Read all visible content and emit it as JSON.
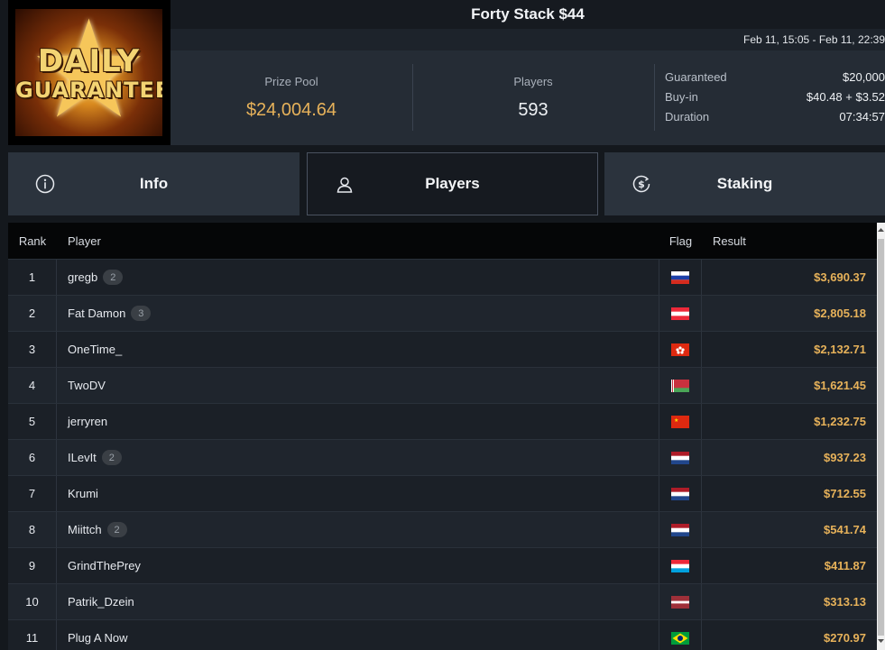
{
  "logo": {
    "line1": "DAILY",
    "line2": "GUARANTEES"
  },
  "title": "Forty Stack $44",
  "date_range": "Feb 11, 15:05 - Feb 11, 22:39",
  "prize_pool": {
    "label": "Prize Pool",
    "value": "$24,004.64"
  },
  "players_stat": {
    "label": "Players",
    "value": "593"
  },
  "details": [
    {
      "key": "Guaranteed",
      "value": "$20,000"
    },
    {
      "key": "Buy-in",
      "value": "$40.48 + $3.52"
    },
    {
      "key": "Duration",
      "value": "07:34:57"
    }
  ],
  "tabs": [
    {
      "label": "Info",
      "icon": "info-icon"
    },
    {
      "label": "Players",
      "icon": "user-icon",
      "active": true
    },
    {
      "label": "Staking",
      "icon": "dollar-coin-icon"
    }
  ],
  "table": {
    "headers": {
      "rank": "Rank",
      "player": "Player",
      "flag": "Flag",
      "result": "Result"
    },
    "rows": [
      {
        "rank": "1",
        "player": "gregb",
        "badge": "2",
        "flag": "russia",
        "result": "$3,690.37"
      },
      {
        "rank": "2",
        "player": "Fat Damon",
        "badge": "3",
        "flag": "austria",
        "result": "$2,805.18"
      },
      {
        "rank": "3",
        "player": "OneTime_",
        "badge": "",
        "flag": "hong-kong",
        "result": "$2,132.71"
      },
      {
        "rank": "4",
        "player": "TwoDV",
        "badge": "",
        "flag": "belarus",
        "result": "$1,621.45"
      },
      {
        "rank": "5",
        "player": "jerryren",
        "badge": "",
        "flag": "china",
        "result": "$1,232.75"
      },
      {
        "rank": "6",
        "player": "ILevIt",
        "badge": "2",
        "flag": "netherlands",
        "result": "$937.23"
      },
      {
        "rank": "7",
        "player": "Krumi",
        "badge": "",
        "flag": "netherlands",
        "result": "$712.55"
      },
      {
        "rank": "8",
        "player": "Miittch",
        "badge": "2",
        "flag": "netherlands",
        "result": "$541.74"
      },
      {
        "rank": "9",
        "player": "GrindThePrey",
        "badge": "",
        "flag": "luxembourg",
        "result": "$411.87"
      },
      {
        "rank": "10",
        "player": "Patrik_Dzein",
        "badge": "",
        "flag": "latvia",
        "result": "$313.13"
      },
      {
        "rank": "11",
        "player": "Plug A Now",
        "badge": "",
        "flag": "brazil",
        "result": "$270.97"
      }
    ]
  },
  "colors": {
    "accent_gold": "#e7b25a",
    "panel": "#252c35",
    "background": "#14181d"
  }
}
